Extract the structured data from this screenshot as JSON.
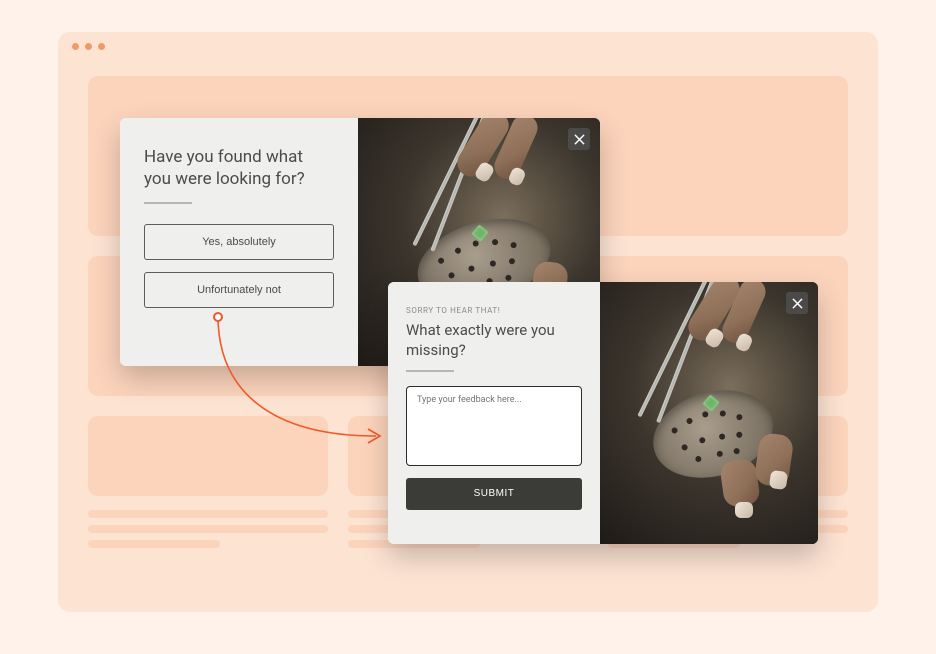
{
  "modal1": {
    "question": "Have you found what you were looking for?",
    "option_yes": "Yes, absolutely",
    "option_no": "Unfortunately not"
  },
  "modal2": {
    "overline": "SORRY TO HEAR THAT!",
    "question": "What exactly were you missing?",
    "placeholder": "Type your feedback here...",
    "submit_label": "SUBMIT"
  },
  "colors": {
    "accent": "#F05A28",
    "page_bg": "#FDE3D2",
    "skeleton": "#FCD4BC",
    "modal_panel": "#EFEFEE"
  }
}
